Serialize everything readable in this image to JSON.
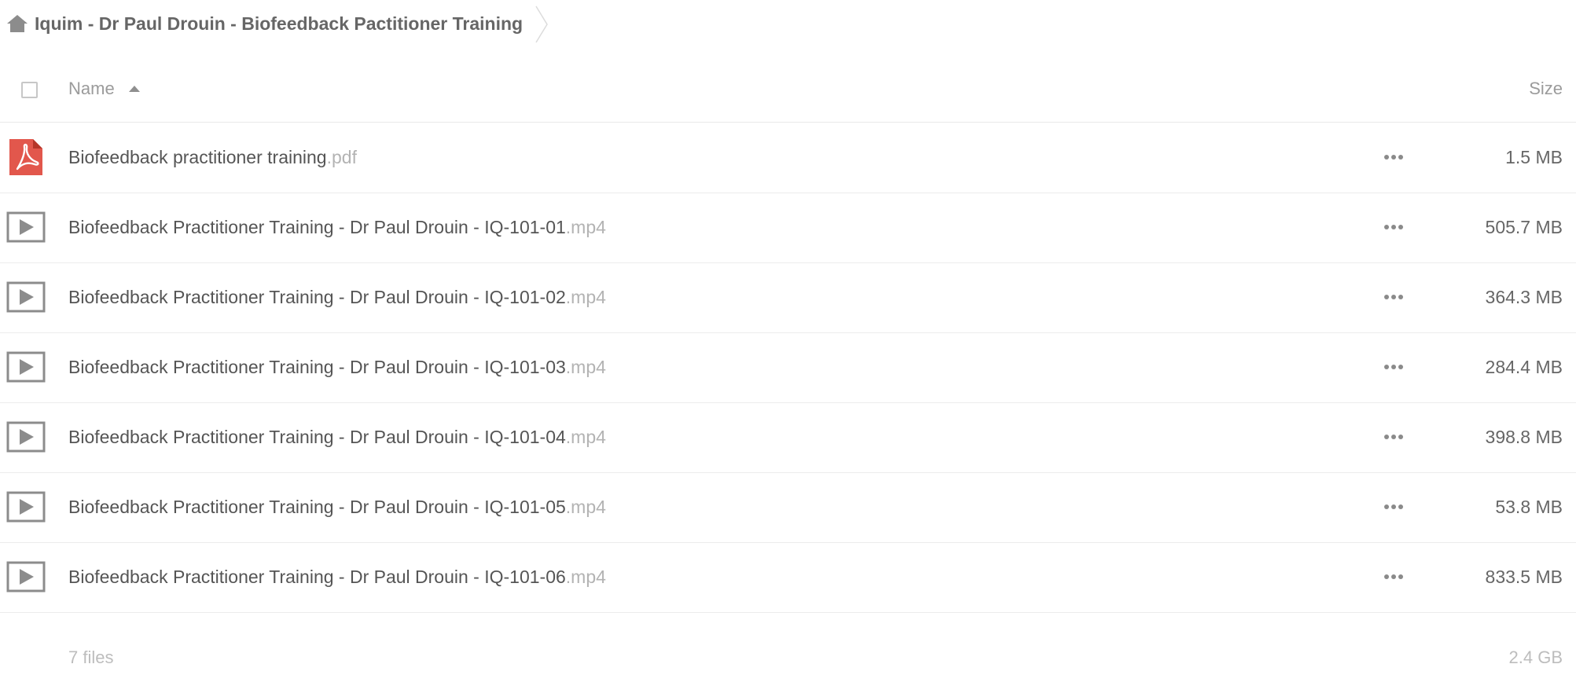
{
  "breadcrumb": {
    "home_icon": "home-icon",
    "folder": "Iquim - Dr Paul Drouin - Biofeedback Pactitioner Training"
  },
  "table": {
    "columns": {
      "name": "Name",
      "size": "Size"
    },
    "sort": {
      "column": "name",
      "direction": "ascending"
    },
    "files": [
      {
        "basename": "Biofeedback practitioner training",
        "ext": ".pdf",
        "size": "1.5 MB",
        "icon": "pdf-file-icon"
      },
      {
        "basename": "Biofeedback Practitioner Training - Dr Paul Drouin - IQ-101-01",
        "ext": ".mp4",
        "size": "505.7 MB",
        "icon": "video-file-icon"
      },
      {
        "basename": "Biofeedback Practitioner Training - Dr Paul Drouin - IQ-101-02",
        "ext": ".mp4",
        "size": "364.3 MB",
        "icon": "video-file-icon"
      },
      {
        "basename": "Biofeedback Practitioner Training - Dr Paul Drouin - IQ-101-03",
        "ext": ".mp4",
        "size": "284.4 MB",
        "icon": "video-file-icon"
      },
      {
        "basename": "Biofeedback Practitioner Training - Dr Paul Drouin - IQ-101-04",
        "ext": ".mp4",
        "size": "398.8 MB",
        "icon": "video-file-icon"
      },
      {
        "basename": "Biofeedback Practitioner Training - Dr Paul Drouin - IQ-101-05",
        "ext": ".mp4",
        "size": "53.8 MB",
        "icon": "video-file-icon"
      },
      {
        "basename": "Biofeedback Practitioner Training - Dr Paul Drouin - IQ-101-06",
        "ext": ".mp4",
        "size": "833.5 MB",
        "icon": "video-file-icon"
      }
    ]
  },
  "summary": {
    "count": "7 files",
    "total_size": "2.4 GB"
  },
  "colors": {
    "pdf_red": "#e2574c",
    "icon_gray": "#8c8c8c",
    "text": "#555555",
    "muted": "#b3b3b3"
  }
}
